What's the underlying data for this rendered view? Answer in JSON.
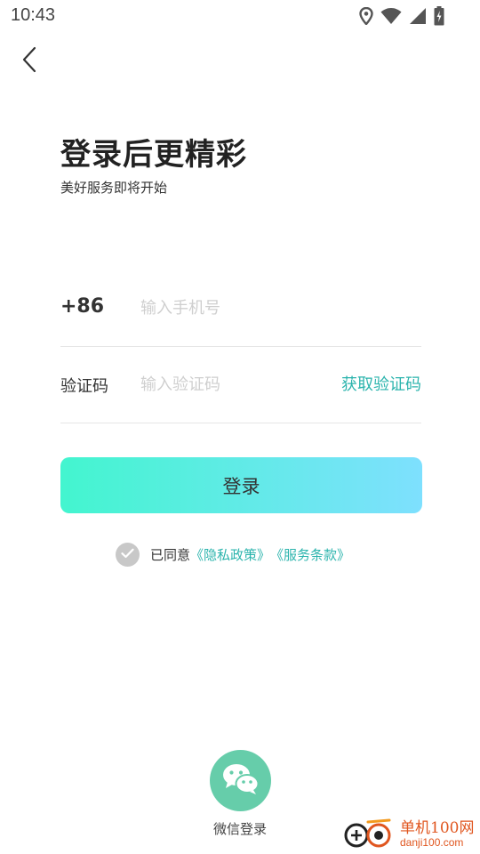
{
  "status_bar": {
    "time": "10:43",
    "icons": [
      "location-icon",
      "wifi-icon",
      "signal-icon",
      "battery-charging-icon"
    ]
  },
  "header": {
    "back_icon": "chevron-left-icon",
    "title": "登录后更精彩",
    "subtitle": "美好服务即将开始"
  },
  "form": {
    "phone": {
      "country_code": "+86",
      "placeholder": "输入手机号",
      "value": ""
    },
    "code": {
      "label": "验证码",
      "placeholder": "输入验证码",
      "value": "",
      "get_code_label": "获取验证码"
    },
    "login_label": "登录"
  },
  "agreement": {
    "checked": true,
    "prefix": "已同意",
    "privacy_link": "《隐私政策》",
    "terms_link": "《服务条款》"
  },
  "social_login": {
    "wechat_label": "微信登录",
    "icon": "wechat-icon"
  },
  "watermark": {
    "name": "单机100网",
    "url": "danji100.com"
  },
  "colors": {
    "accent": "#2cb4ad",
    "gradient_start": "#43f5cf",
    "gradient_end": "#7ee0fe",
    "wechat_bg": "#66cdaa",
    "watermark": "#e0561f"
  }
}
